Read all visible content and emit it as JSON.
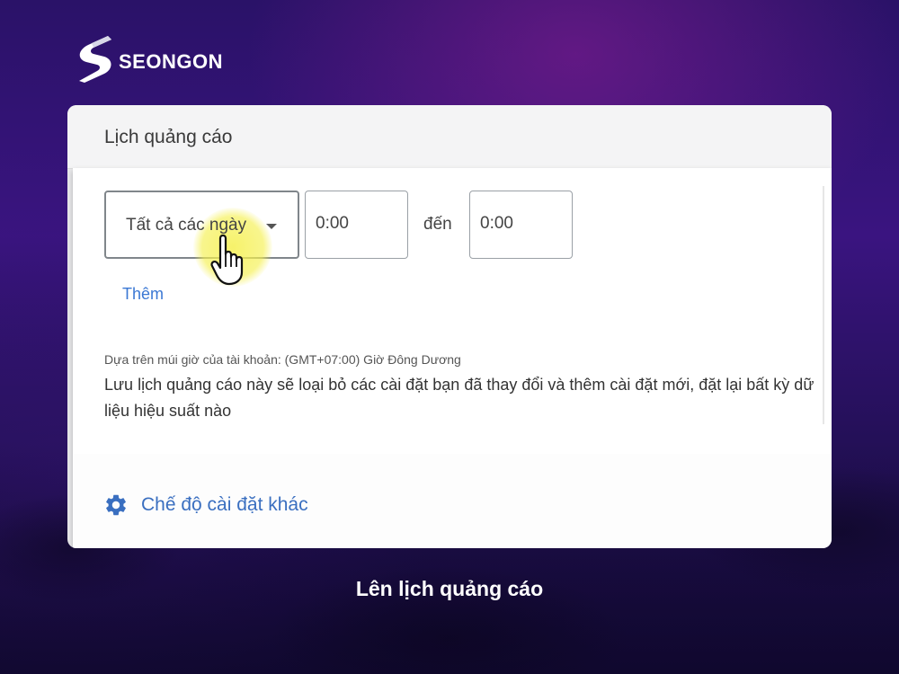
{
  "brand": {
    "name": "SEONGON"
  },
  "card": {
    "title": "Lịch quảng cáo",
    "schedule": {
      "day_select": "Tất cả các ngày",
      "start_time": "0:00",
      "separator": "đến",
      "end_time": "0:00"
    },
    "add_link": "Thêm",
    "timezone_note": "Dựa trên múi giờ của tài khoản: (GMT+07:00) Giờ Đông Dương",
    "warning": "Lưu lịch quảng cáo này sẽ loại bỏ các cài đặt bạn đã thay đổi và thêm cài đặt mới, đặt lại bất kỳ dữ liệu hiệu suất nào",
    "more_settings": "Chế độ cài đặt khác"
  },
  "caption": "Lên lịch quảng cáo",
  "colors": {
    "accent": "#3b78d4",
    "highlight": "#f5f050"
  },
  "icons": {
    "logo": "seongon-logo",
    "cursor": "hand-pointer-icon",
    "settings": "gear-icon",
    "dropdown": "caret-down-icon"
  }
}
